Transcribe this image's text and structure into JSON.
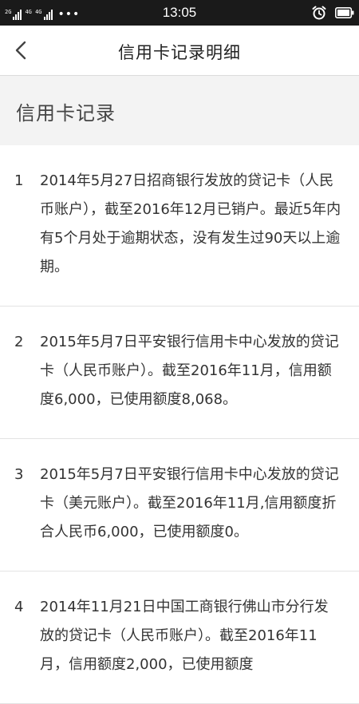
{
  "status_bar": {
    "time": "13:05",
    "network_left": "2G",
    "network_right": "4G 4G",
    "dots": "•••",
    "icons": [
      "signal-icon",
      "signal-icon",
      "alarm-icon",
      "battery-icon"
    ]
  },
  "nav": {
    "back_icon": "chevron-left-icon",
    "title": "信用卡记录明细"
  },
  "section": {
    "title": "信用卡记录"
  },
  "records": [
    {
      "index": "1",
      "text": "2014年5月27日招商银行发放的贷记卡（人民币账户），截至2016年12月已销户。最近5年内有5个月处于逾期状态，没有发生过90天以上逾期。"
    },
    {
      "index": "2",
      "text": "2015年5月7日平安银行信用卡中心发放的贷记卡（人民币账户）。截至2016年11月，信用额度6,000，已使用额度8,068。"
    },
    {
      "index": "3",
      "text": "2015年5月7日平安银行信用卡中心发放的贷记卡（美元账户）。截至2016年11月,信用额度折合人民币6,000，已使用额度0。"
    },
    {
      "index": "4",
      "text": "2014年11月21日中国工商银行佛山市分行发放的贷记卡（人民币账户）。截至2016年11月，信用额度2,000，已使用额度"
    }
  ]
}
